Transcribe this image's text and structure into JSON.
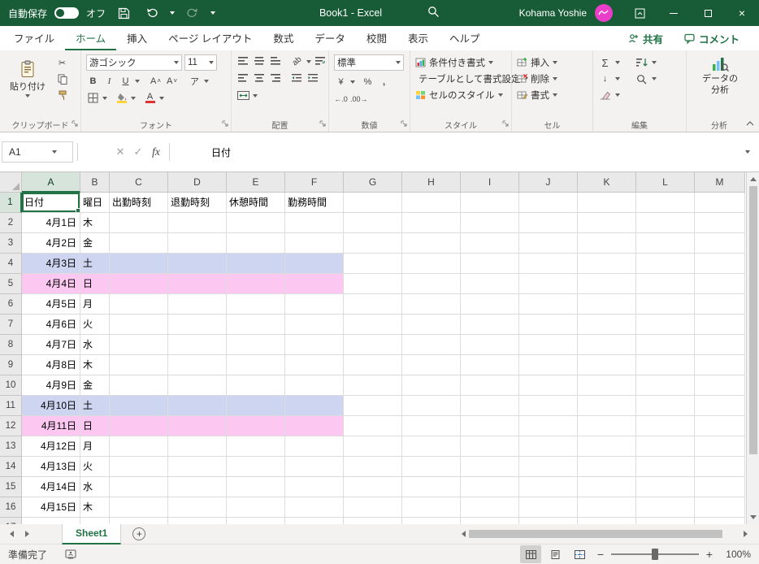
{
  "theme": {
    "titlebar_green": "#185c37",
    "accent_green": "#217346",
    "saturday_fill": "#cdd5f1",
    "sunday_fill": "#fcc7f1"
  },
  "titlebar": {
    "autosave_label": "自動保存",
    "autosave_state": "オフ",
    "title": "Book1 - Excel",
    "user_name": "Kohama Yoshie"
  },
  "tabs": {
    "items": [
      {
        "label": "ファイル",
        "active": false
      },
      {
        "label": "ホーム",
        "active": true
      },
      {
        "label": "挿入",
        "active": false
      },
      {
        "label": "ページ レイアウト",
        "active": false
      },
      {
        "label": "数式",
        "active": false
      },
      {
        "label": "データ",
        "active": false
      },
      {
        "label": "校閲",
        "active": false
      },
      {
        "label": "表示",
        "active": false
      },
      {
        "label": "ヘルプ",
        "active": false
      }
    ],
    "share_label": "共有",
    "comments_label": "コメント"
  },
  "ribbon": {
    "clipboard": {
      "paste_label": "貼り付け",
      "group_label": "クリップボード"
    },
    "font": {
      "font_name": "游ゴシック",
      "font_size": "11",
      "group_label": "フォント"
    },
    "alignment": {
      "group_label": "配置"
    },
    "number": {
      "format": "標準",
      "group_label": "数値"
    },
    "styles": {
      "conditional": "条件付き書式",
      "table_format": "テーブルとして書式設定",
      "cell_styles": "セルのスタイル",
      "group_label": "スタイル"
    },
    "cells": {
      "insert": "挿入",
      "delete": "削除",
      "format": "書式",
      "group_label": "セル"
    },
    "editing": {
      "group_label": "編集"
    },
    "analysis": {
      "button_label": "データの分析",
      "group_label": "分析"
    }
  },
  "formula_bar": {
    "name_box": "A1",
    "value": "日付"
  },
  "grid": {
    "columns": [
      "A",
      "B",
      "C",
      "D",
      "E",
      "F",
      "G",
      "H",
      "I",
      "J",
      "K",
      "L",
      "M"
    ],
    "header_cells": [
      "日付",
      "曜日",
      "出勤時刻",
      "退勤時刻",
      "休憩時間",
      "勤務時間"
    ],
    "selected_cell": "A1",
    "rows": [
      {
        "date": "4月1日",
        "day": "木",
        "highlight": null
      },
      {
        "date": "4月2日",
        "day": "金",
        "highlight": null
      },
      {
        "date": "4月3日",
        "day": "土",
        "highlight": "saturday"
      },
      {
        "date": "4月4日",
        "day": "日",
        "highlight": "sunday"
      },
      {
        "date": "4月5日",
        "day": "月",
        "highlight": null
      },
      {
        "date": "4月6日",
        "day": "火",
        "highlight": null
      },
      {
        "date": "4月7日",
        "day": "水",
        "highlight": null
      },
      {
        "date": "4月8日",
        "day": "木",
        "highlight": null
      },
      {
        "date": "4月9日",
        "day": "金",
        "highlight": null
      },
      {
        "date": "4月10日",
        "day": "土",
        "highlight": "saturday"
      },
      {
        "date": "4月11日",
        "day": "日",
        "highlight": "sunday"
      },
      {
        "date": "4月12日",
        "day": "月",
        "highlight": null
      },
      {
        "date": "4月13日",
        "day": "火",
        "highlight": null
      },
      {
        "date": "4月14日",
        "day": "水",
        "highlight": null
      },
      {
        "date": "4月15日",
        "day": "木",
        "highlight": null
      }
    ]
  },
  "sheet_bar": {
    "active_tab": "Sheet1"
  },
  "status_bar": {
    "mode": "準備完了",
    "zoom": "100%"
  }
}
